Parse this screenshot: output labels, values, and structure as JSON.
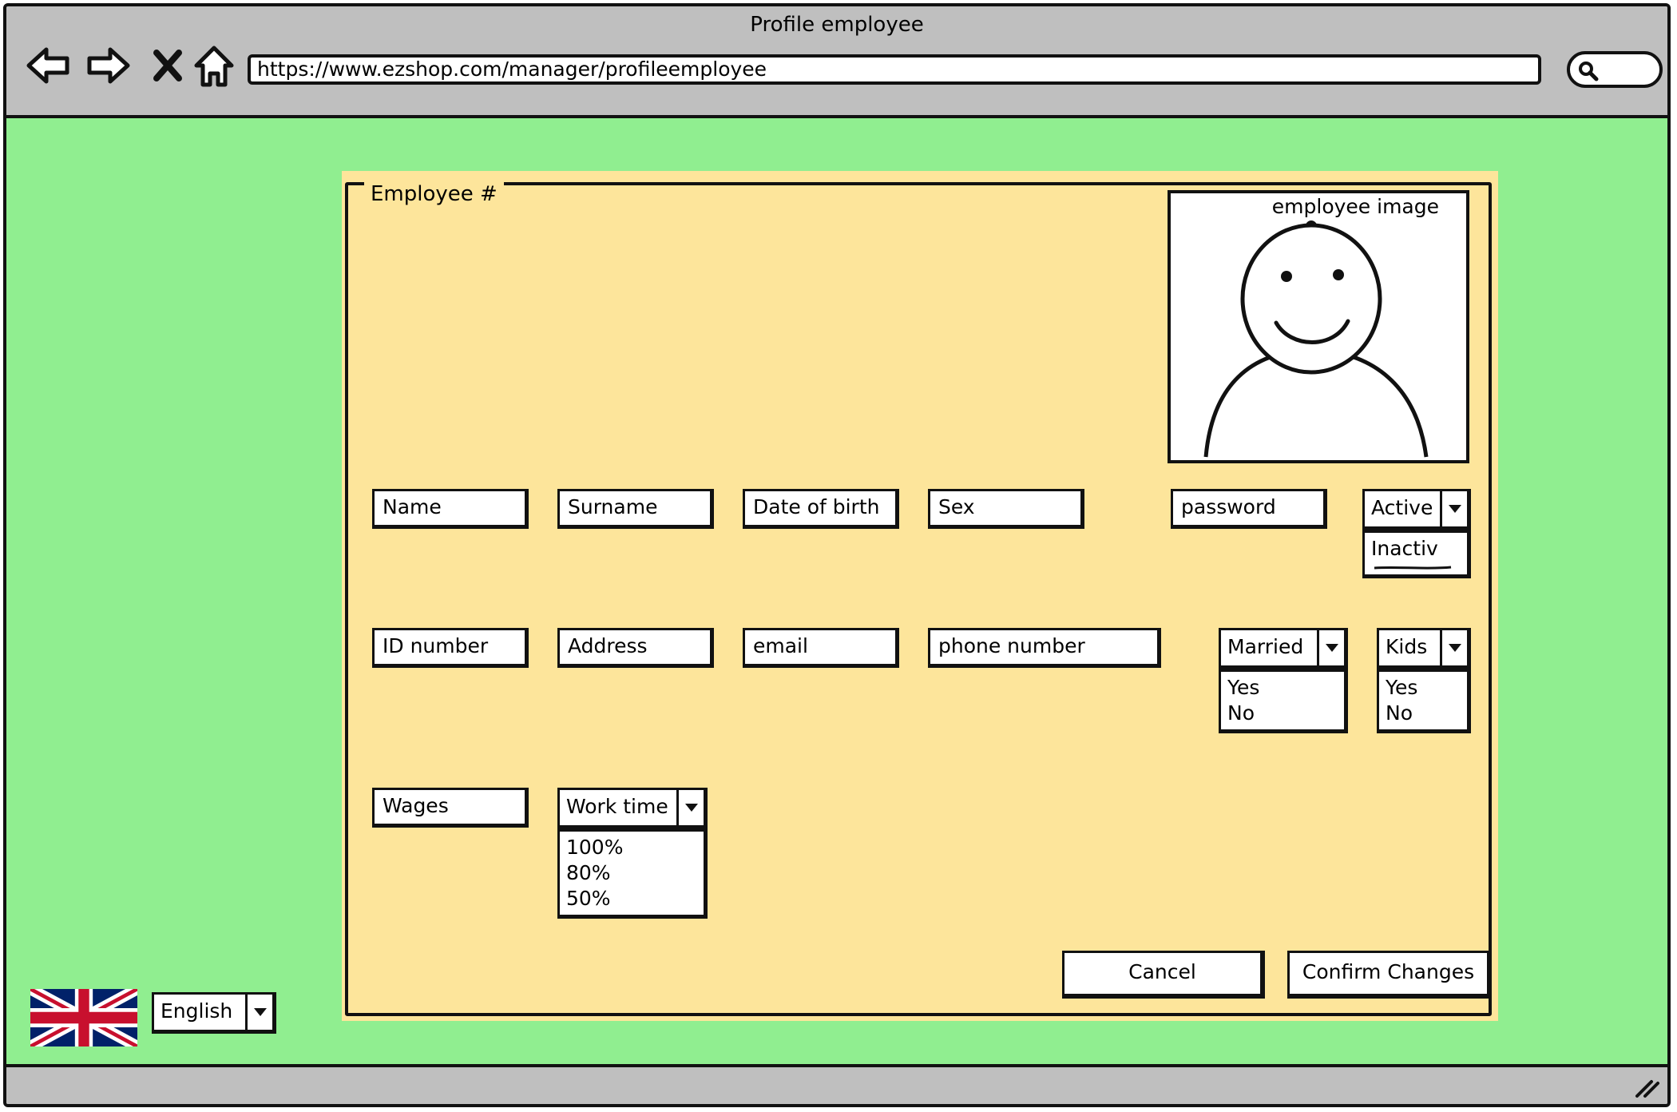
{
  "window": {
    "title": "Profile employee"
  },
  "browser": {
    "url": "https://www.ezshop.com/manager/profileemployee",
    "nav_icons": [
      "back-arrow-icon",
      "forward-arrow-icon",
      "close-icon",
      "home-icon",
      "search-icon"
    ]
  },
  "form": {
    "legend": "Employee #",
    "image_caption": "employee image",
    "fields": {
      "name": "Name",
      "surname": "Surname",
      "date_of_birth": "Date of birth",
      "sex": "Sex",
      "password": "password",
      "id_number": "ID number",
      "address": "Address",
      "email": "email",
      "phone": "phone number",
      "wages": "Wages"
    },
    "status": {
      "selected": "Active",
      "options": [
        "Inactiv"
      ]
    },
    "married": {
      "selected": "Married",
      "options": [
        "Yes",
        "No"
      ]
    },
    "kids": {
      "selected": "Kids",
      "options": [
        "Yes",
        "No"
      ]
    },
    "work_time": {
      "selected": "Work time",
      "options": [
        "100%",
        "80%",
        "50%"
      ]
    },
    "buttons": {
      "cancel": "Cancel",
      "confirm": "Confirm Changes"
    }
  },
  "language": {
    "selected": "English",
    "flag": "uk-flag"
  },
  "colors": {
    "background": "#90ee90",
    "panel": "#fde59b",
    "chrome": "#bfbfbf"
  }
}
